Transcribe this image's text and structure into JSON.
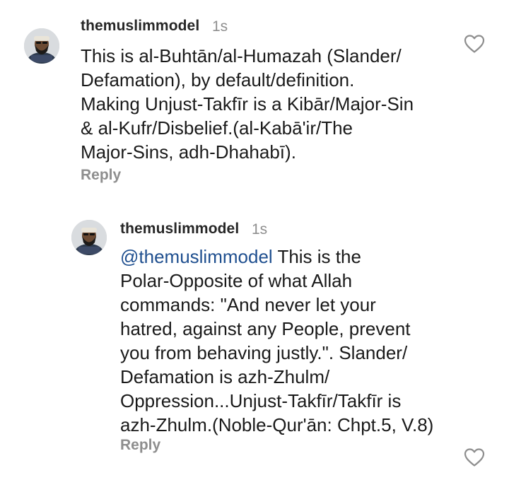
{
  "comments": [
    {
      "username": "themuslimmodel",
      "timestamp": "1s",
      "mention": "",
      "lines": [
        "This is al-Buhtān/al-Humazah (Slander/",
        "Defamation), by default/definition.",
        "Making Unjust-Takfīr is a Kibār/Major-Sin",
        "& al-Kufr/Disbelief.(al-Kabā'ir/The",
        "Major-Sins, adh-Dhahabī)."
      ],
      "reply_label": "Reply",
      "like_icon": "heart-outline-icon"
    },
    {
      "username": "themuslimmodel",
      "timestamp": "1s",
      "mention": "@themuslimmodel",
      "first_line_rest": " This is the",
      "lines": [
        "Polar-Opposite of what Allah",
        "commands: \"And never let your",
        "hatred, against any People, prevent",
        "you from behaving justly.\". Slander/",
        "Defamation is azh-Zhulm/",
        "Oppression...Unjust-Takfīr/Takfīr is",
        "azh-Zhulm.(Noble-Qur'ān: Chpt.5, V.8)"
      ],
      "reply_label": "Reply",
      "like_icon": "heart-outline-icon"
    }
  ],
  "colors": {
    "username": "#262626",
    "muted": "#8e8e8e",
    "mention": "#1f4f8f",
    "text": "#1a1a1a"
  }
}
